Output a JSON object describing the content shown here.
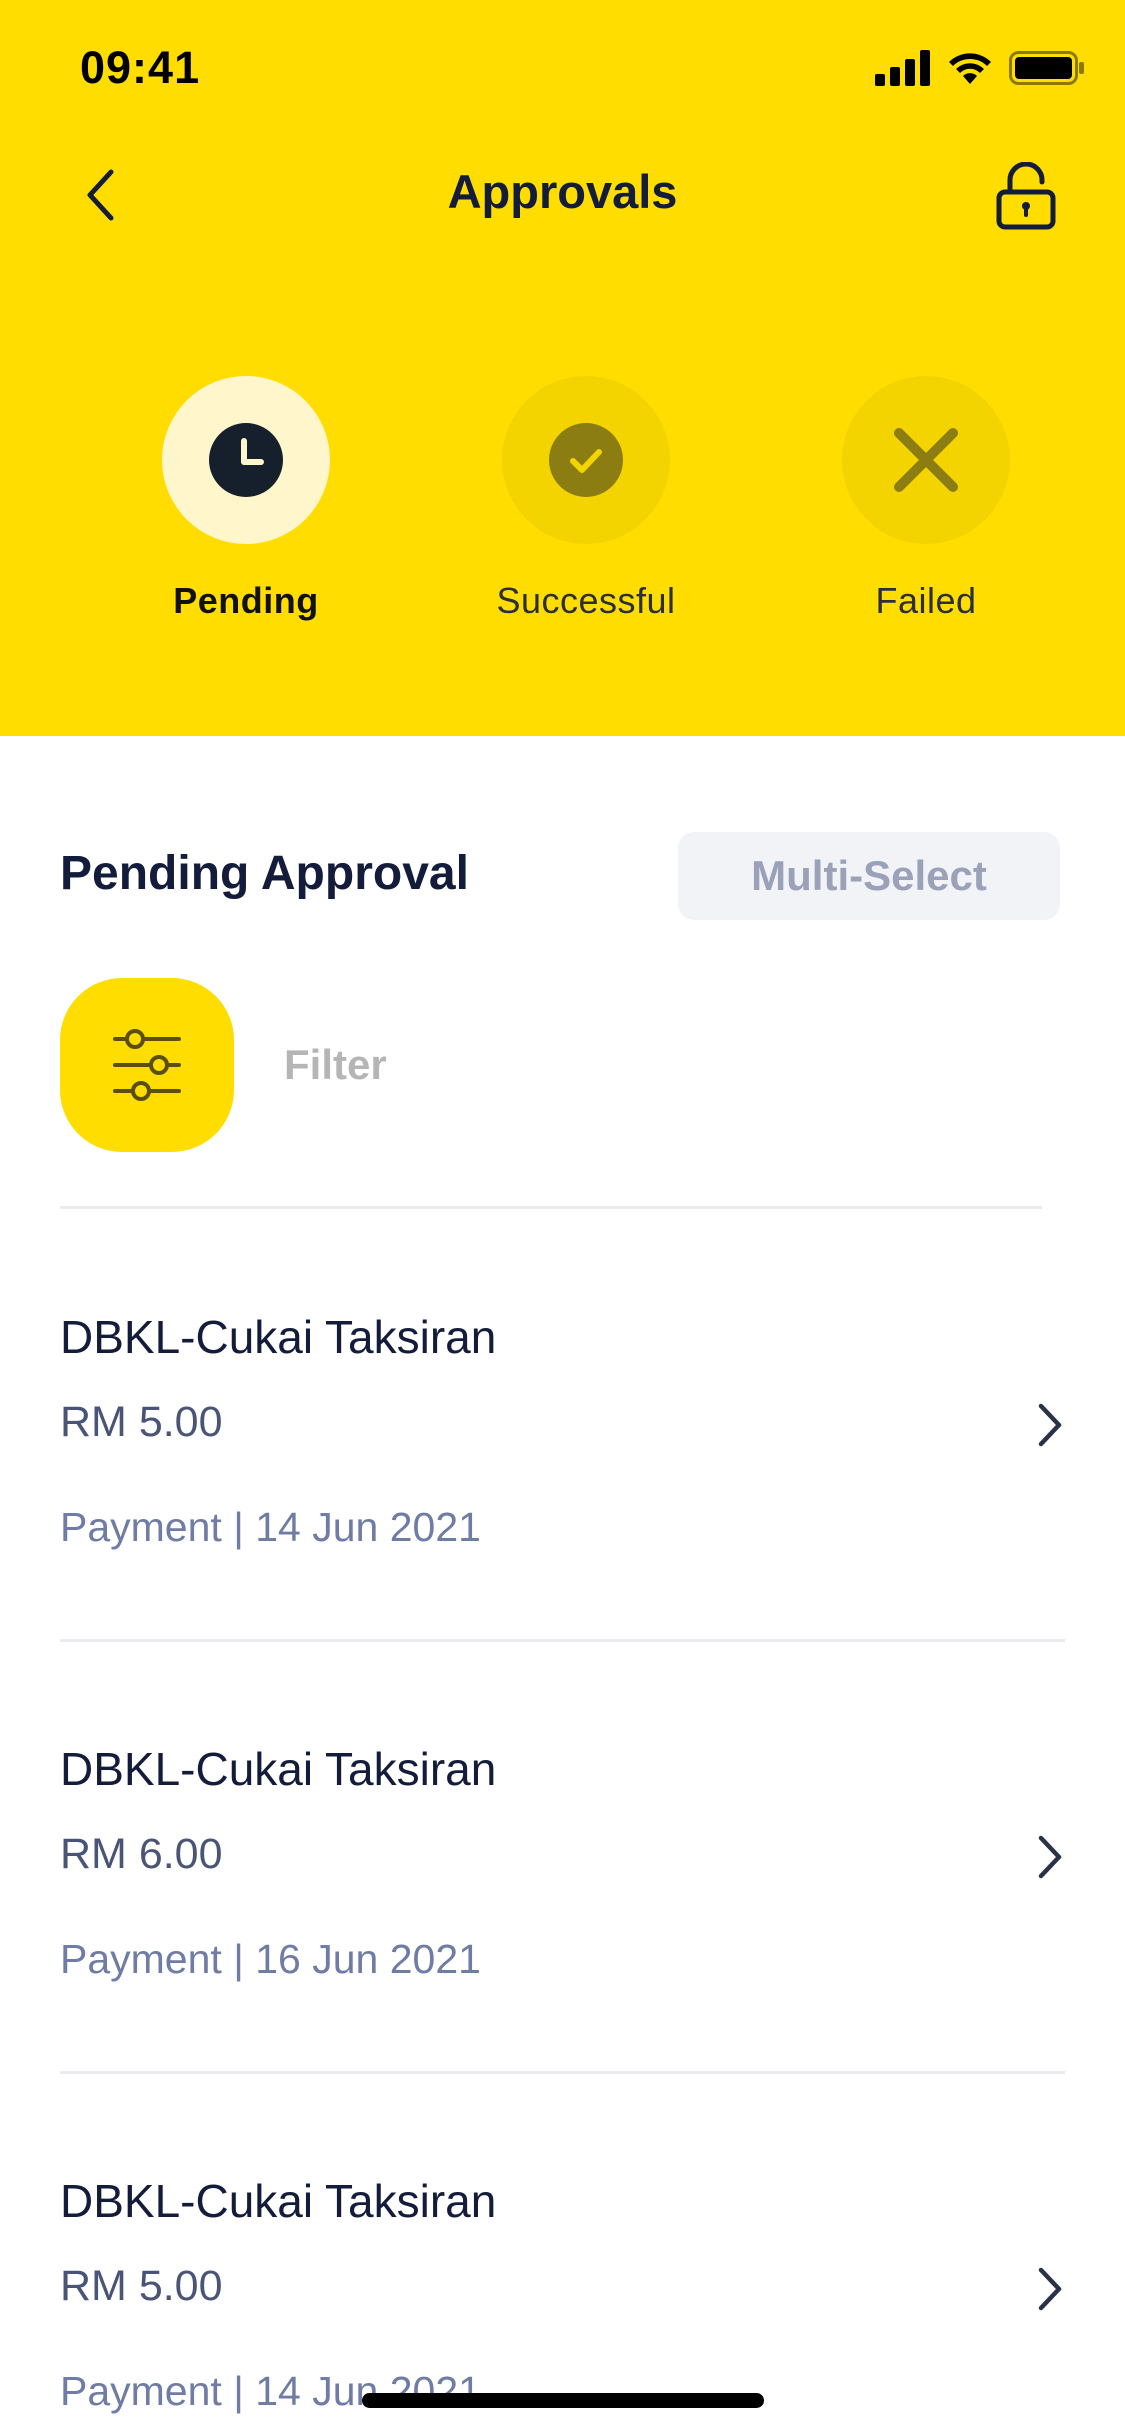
{
  "status_bar": {
    "time": "09:41"
  },
  "nav": {
    "title": "Approvals"
  },
  "tabs": [
    {
      "label": "Pending",
      "active": true,
      "icon": "clock-icon"
    },
    {
      "label": "Successful",
      "active": false,
      "icon": "check-circle-icon"
    },
    {
      "label": "Failed",
      "active": false,
      "icon": "x-icon"
    }
  ],
  "section": {
    "title": "Pending Approval",
    "multi_select_label": "Multi-Select",
    "filter_label": "Filter"
  },
  "approvals": [
    {
      "title": "DBKL-Cukai Taksiran",
      "amount": "RM 5.00",
      "meta": "Payment | 14 Jun 2021"
    },
    {
      "title": "DBKL-Cukai Taksiran",
      "amount": "RM 6.00",
      "meta": "Payment | 16 Jun 2021"
    },
    {
      "title": "DBKL-Cukai Taksiran",
      "amount": "RM 5.00",
      "meta": "Payment | 14 Jun 2021"
    }
  ],
  "colors": {
    "brand_yellow": "#FFDD00",
    "text_dark": "#131C3A",
    "text_muted": "#6F7CA3"
  }
}
